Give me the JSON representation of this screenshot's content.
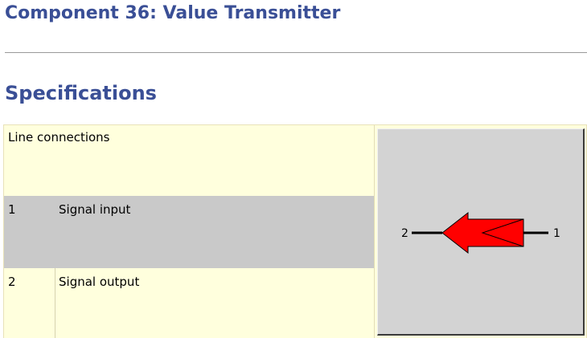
{
  "page": {
    "title": "Component 36: Value Transmitter",
    "section_title": "Specifications"
  },
  "table": {
    "header_label": "Line connections",
    "rows": [
      {
        "number": "1",
        "label": "Signal input"
      },
      {
        "number": "2",
        "label": "Signal output"
      }
    ]
  },
  "symbol": {
    "input_port_label": "1",
    "output_port_label": "2",
    "arrow_color": "#ff0000",
    "panel_color": "#d3d3d3"
  },
  "colors": {
    "heading": "#3a4f96",
    "table_background": "#ffffdd",
    "highlight_row": "#c9c9c9"
  }
}
